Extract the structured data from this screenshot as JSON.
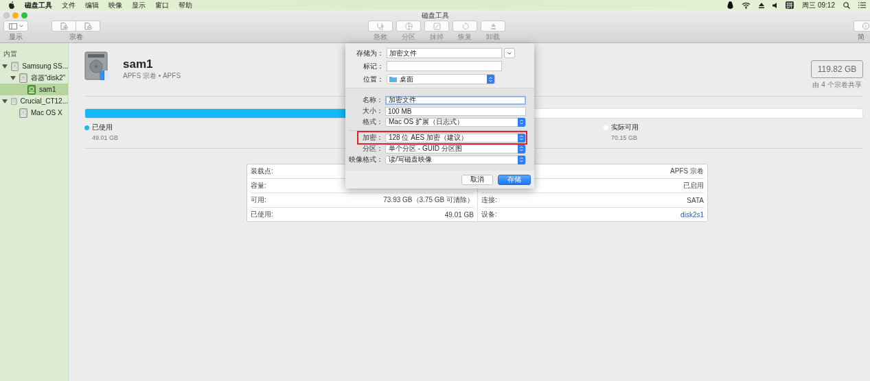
{
  "menu_bar": {
    "items": [
      {
        "label": "磁盘工具",
        "kind": "app"
      },
      {
        "label": "文件",
        "kind": "menu"
      },
      {
        "label": "编辑",
        "kind": "menu"
      },
      {
        "label": "映像",
        "kind": "menu"
      },
      {
        "label": "显示",
        "kind": "menu"
      },
      {
        "label": "窗口",
        "kind": "menu"
      },
      {
        "label": "帮助",
        "kind": "menu"
      }
    ],
    "input_method": "拼",
    "clock": "周三 09:12"
  },
  "window": {
    "title": "磁盘工具",
    "toolbar": {
      "left": [
        {
          "label": "显示",
          "kind": "sidebar"
        },
        {
          "label": "宗卷",
          "kind": "volume"
        }
      ],
      "actions": [
        {
          "label": "急救",
          "kind": "first-aid",
          "disabled": true
        },
        {
          "label": "分区",
          "kind": "partition",
          "disabled": true
        },
        {
          "label": "抹掉",
          "kind": "erase",
          "disabled": true
        },
        {
          "label": "恢复",
          "kind": "restore",
          "disabled": true
        },
        {
          "label": "卸载",
          "kind": "unmount",
          "disabled": true
        }
      ],
      "right": [
        {
          "label": "简",
          "kind": "info"
        }
      ]
    }
  },
  "sidebar": {
    "heading": "内置",
    "items": [
      {
        "label": "Samsung SS...",
        "expanded": true,
        "selected": false,
        "children": [
          {
            "label": "容器“disk2”",
            "expanded": true,
            "selected": false,
            "children": [
              {
                "label": "sam1",
                "selected": true
              }
            ]
          }
        ]
      },
      {
        "label": "Crucial_CT12...",
        "expanded": true,
        "selected": false,
        "children": [
          {
            "label": "Mac OS X",
            "selected": false
          }
        ]
      }
    ]
  },
  "volume": {
    "name": "sam1",
    "subtitle": "APFS 宗卷 • APFS",
    "capacity": "119.82 GB",
    "capacity_note": "由 4 个宗卷共享",
    "usage": {
      "level": 0.41,
      "legend": [
        {
          "label": "已使用",
          "value": "49.01 GB",
          "color": "#1ab8f5"
        },
        {
          "label": "实际可用",
          "value": "70.15 GB",
          "color": "#ffffff"
        }
      ]
    }
  },
  "info_table": {
    "left": [
      {
        "label": "装载点:"
      },
      {
        "label": "容量:"
      },
      {
        "label": "可用:",
        "value": "73.93 GB（3.75 GB 可清除）"
      },
      {
        "label": "已使用:",
        "value": "49.01 GB"
      }
    ],
    "right": [
      {
        "value": "APFS 宗卷"
      },
      {
        "value": "已启用"
      },
      {
        "label": "连接:",
        "value": "SATA"
      },
      {
        "label": "设备:",
        "value": "disk2s1"
      }
    ]
  },
  "save_sheet": {
    "save_as": {
      "label": "存储为：",
      "value": "加密文件"
    },
    "tags": {
      "label": "标记："
    },
    "where": {
      "label": "位置：",
      "value": "桌面"
    },
    "options": [
      {
        "label": "名称：",
        "value": "加密文件",
        "kind": "text",
        "focused": true
      },
      {
        "label": "大小：",
        "value": "100 MB",
        "kind": "text",
        "focused": false
      },
      {
        "label": "格式：",
        "value": "Mac OS 扩展（日志式）",
        "kind": "popup",
        "highlighted": false
      },
      {
        "label": "加密：",
        "value": "128 位 AES 加密（建议）",
        "kind": "popup",
        "highlighted": true
      },
      {
        "label": "分区：",
        "value": "单个分区 - GUID 分区图",
        "kind": "popup",
        "highlighted": false
      },
      {
        "label": "映像格式：",
        "value": "读/写磁盘映像",
        "kind": "popup",
        "highlighted": false
      }
    ],
    "buttons": [
      {
        "label": "取消",
        "default": false
      },
      {
        "label": "存储",
        "default": true
      }
    ]
  }
}
